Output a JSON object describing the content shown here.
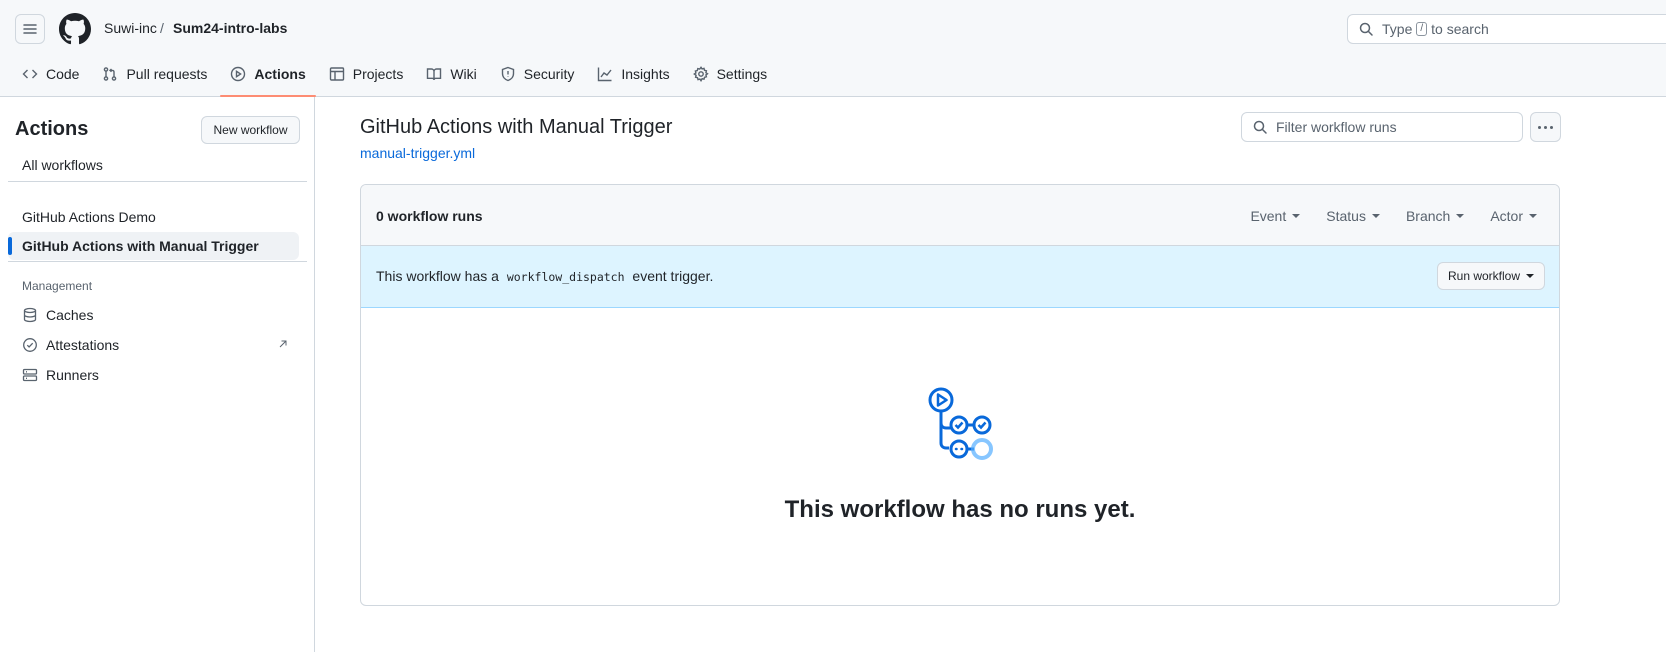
{
  "header": {
    "owner": "Suwi-inc",
    "separator": "/",
    "repo": "Sum24-intro-labs",
    "search_prefix": "Type",
    "search_key": "/",
    "search_suffix": "to search"
  },
  "tabs": [
    {
      "label": "Code",
      "icon": "code-icon"
    },
    {
      "label": "Pull requests",
      "icon": "pull-request-icon"
    },
    {
      "label": "Actions",
      "icon": "play-icon"
    },
    {
      "label": "Projects",
      "icon": "table-icon"
    },
    {
      "label": "Wiki",
      "icon": "book-icon"
    },
    {
      "label": "Security",
      "icon": "shield-icon"
    },
    {
      "label": "Insights",
      "icon": "graph-icon"
    },
    {
      "label": "Settings",
      "icon": "gear-icon"
    }
  ],
  "sidebar": {
    "title": "Actions",
    "new_workflow": "New workflow",
    "all_workflows": "All workflows",
    "workflows": [
      "GitHub Actions Demo",
      "GitHub Actions with Manual Trigger"
    ],
    "management_heading": "Management",
    "management": [
      {
        "label": "Caches",
        "icon": "database-icon"
      },
      {
        "label": "Attestations",
        "icon": "verified-icon"
      },
      {
        "label": "Runners",
        "icon": "server-icon"
      }
    ]
  },
  "main": {
    "title": "GitHub Actions with Manual Trigger",
    "file_link": "manual-trigger.yml",
    "filter_placeholder": "Filter workflow runs",
    "runs_count": "0 workflow runs",
    "filters": [
      "Event",
      "Status",
      "Branch",
      "Actor"
    ],
    "banner_prefix": "This workflow has a",
    "banner_code": "workflow_dispatch",
    "banner_suffix": "event trigger.",
    "run_workflow": "Run workflow",
    "empty_message": "This workflow has no runs yet."
  },
  "colors": {
    "accent": "#0969da",
    "tab_underline": "#fd8c73",
    "banner_bg": "#ddf4ff"
  }
}
